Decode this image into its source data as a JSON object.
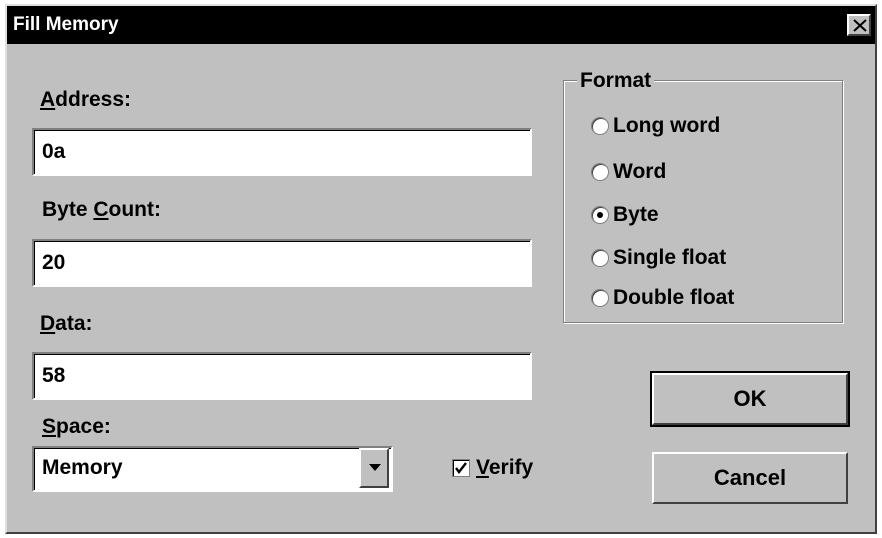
{
  "window": {
    "title": "Fill Memory"
  },
  "address": {
    "label_accel": "A",
    "label_rest": "ddress:",
    "value": "0a"
  },
  "byte_count": {
    "label_pre": "Byte ",
    "label_accel": "C",
    "label_rest": "ount:",
    "value": "20"
  },
  "data_field": {
    "label_accel": "D",
    "label_rest": "ata:",
    "value": "58"
  },
  "space": {
    "label_accel": "S",
    "label_rest": "pace:",
    "selected": "Memory"
  },
  "verify": {
    "checked": true,
    "label_accel": "V",
    "label_rest": "erify"
  },
  "format": {
    "legend": "Format",
    "selected": "Byte",
    "options": [
      {
        "pre": "",
        "accel": "L",
        "rest": "ong word",
        "checked": false
      },
      {
        "pre": "",
        "accel": "W",
        "rest": "ord",
        "checked": false
      },
      {
        "pre": "",
        "accel": "B",
        "rest": "yte",
        "checked": true
      },
      {
        "pre": "S",
        "accel": "i",
        "rest": "ngle float",
        "checked": false
      },
      {
        "pre": "",
        "accel": "D",
        "rest": "ouble float",
        "checked": false
      }
    ]
  },
  "buttons": {
    "ok": "OK",
    "cancel": "Cancel"
  },
  "icons": {
    "close": "close-icon",
    "dropdown": "chevron-down-icon",
    "check": "check-icon"
  }
}
